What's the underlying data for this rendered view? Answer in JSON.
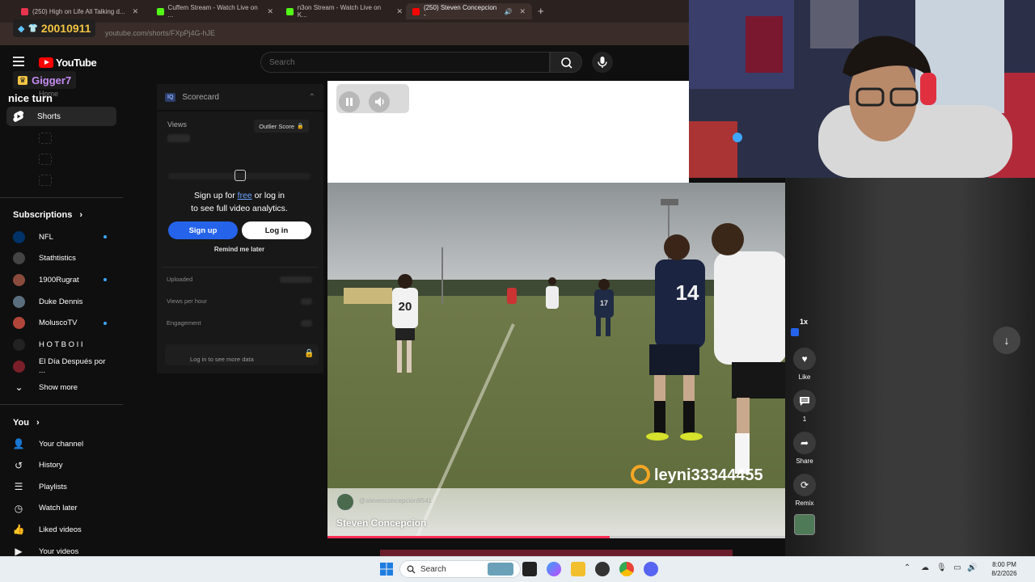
{
  "browser": {
    "tabs": [
      {
        "label": "(250) High on Life All Talking d...",
        "color": "#e8344e"
      },
      {
        "label": "Cuffem Stream - Watch Live on ...",
        "color": "#53fc18"
      },
      {
        "label": "n3on Stream - Watch Live on K...",
        "color": "#53fc18"
      },
      {
        "label": "(250) Steven Concepcion - ",
        "color": "#ff0000"
      }
    ],
    "url": "youtube.com/shorts/FXpPj4G-hJE"
  },
  "overlay": {
    "sub_count": "20010911",
    "chatter_name": "Gigger7",
    "chat_message": "nice turn"
  },
  "youtube": {
    "logo_text": "YouTube",
    "search_placeholder": "Search",
    "home_label": "Home",
    "shorts_label": "Shorts",
    "subscriptions_title": "Subscriptions",
    "subscriptions": [
      {
        "name": "NFL",
        "new": true,
        "color": "#013369"
      },
      {
        "name": "Stathtistics",
        "new": false,
        "color": "#444"
      },
      {
        "name": "1900Rugrat",
        "new": true,
        "color": "#8a4b3c"
      },
      {
        "name": "Duke Dennis",
        "new": false,
        "color": "#5a6e7e"
      },
      {
        "name": "MoluscoTV",
        "new": true,
        "color": "#b0463a"
      },
      {
        "name": "H O T B O I I",
        "new": false,
        "color": "#222"
      },
      {
        "name": "El Día Después por ...",
        "new": false,
        "color": "#7a1f2a"
      }
    ],
    "show_more": "Show more",
    "you_title": "You",
    "you_items": [
      "Your channel",
      "History",
      "Playlists",
      "Watch later",
      "Liked videos",
      "Your videos"
    ]
  },
  "scorecard": {
    "title": "Scorecard",
    "badge": "IQ",
    "views_label": "Views",
    "outlier_label": "Outlier Score",
    "signup_line1_pre": "Sign up for ",
    "signup_free": "free",
    "signup_line1_post": " or log in",
    "signup_line2": "to see full video analytics.",
    "signup_btn": "Sign up",
    "login_btn": "Log in",
    "remind_btn": "Remind me later",
    "rows": [
      "Uploaded",
      "Views per hour",
      "Engagement"
    ],
    "more_data": "Log in to see more data"
  },
  "video": {
    "channel_handle": "@stevenconcepcion9541",
    "title": "Steven Concepcion",
    "watermark": "leyni33344455",
    "progress": 0.617,
    "jersey_numbers": [
      "20",
      "14",
      "17"
    ]
  },
  "actions": {
    "speed": "1x",
    "like_label": "Like",
    "comment_count": "1",
    "share_label": "Share",
    "remix_label": "Remix"
  },
  "taskbar": {
    "search_placeholder": "Search",
    "time": "8:00 PM",
    "date": "8/2/2026"
  }
}
